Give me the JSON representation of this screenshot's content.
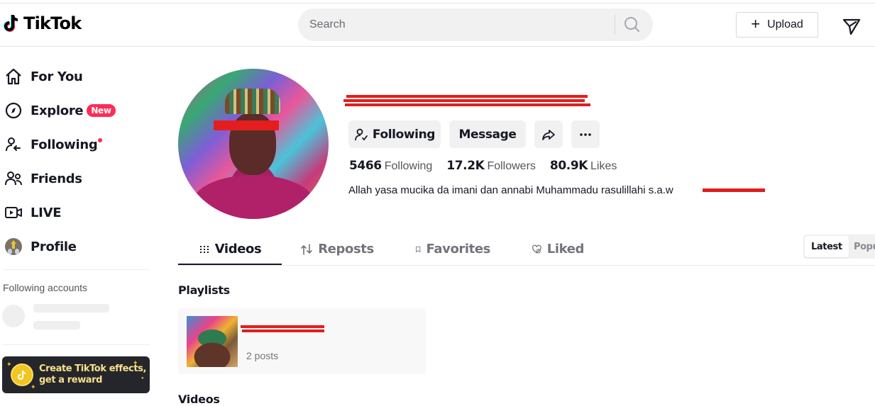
{
  "header": {
    "logo_text": "TikTok",
    "search": {
      "placeholder": "Search",
      "value": ""
    },
    "upload_label": "Upload"
  },
  "sidebar": {
    "nav": [
      {
        "label": "For You",
        "icon": "home-icon"
      },
      {
        "label": "Explore",
        "icon": "compass-icon",
        "badge": "New"
      },
      {
        "label": "Following",
        "icon": "following-icon",
        "dot": true
      },
      {
        "label": "Friends",
        "icon": "friends-icon"
      },
      {
        "label": "LIVE",
        "icon": "live-icon"
      },
      {
        "label": "Profile",
        "icon": "profile-avatar"
      }
    ],
    "following_accounts_heading": "Following accounts",
    "effects_banner": {
      "line1": "Create TikTok effects,",
      "line2": "get a reward"
    }
  },
  "profile": {
    "username": "[redacted]",
    "buttons": {
      "following": "Following",
      "message": "Message"
    },
    "stats": [
      {
        "value": "5466",
        "label": "Following"
      },
      {
        "value": "17.2K",
        "label": "Followers"
      },
      {
        "value": "80.9K",
        "label": "Likes"
      }
    ],
    "bio": "Allah yasa mucika da imani dan annabi Muhammadu rasulillahi s.a.w"
  },
  "tabs": [
    {
      "label": "Videos",
      "icon": "grid-icon",
      "active": true
    },
    {
      "label": "Reposts",
      "icon": "repost-icon",
      "active": false
    },
    {
      "label": "Favorites",
      "icon": "bookmark-icon",
      "active": false
    },
    {
      "label": "Liked",
      "icon": "heart-icon",
      "active": false
    }
  ],
  "sort": {
    "options": [
      "Latest",
      "Popu"
    ],
    "selected": "Latest"
  },
  "sections": {
    "playlists_title": "Playlists",
    "videos_title": "Videos"
  },
  "playlist": {
    "name": "[redacted]",
    "posts": "2 posts"
  },
  "colors": {
    "brand_red": "#fe2c55",
    "text": "#161823",
    "muted": "#73747b",
    "surface": "#f1f1f2"
  }
}
